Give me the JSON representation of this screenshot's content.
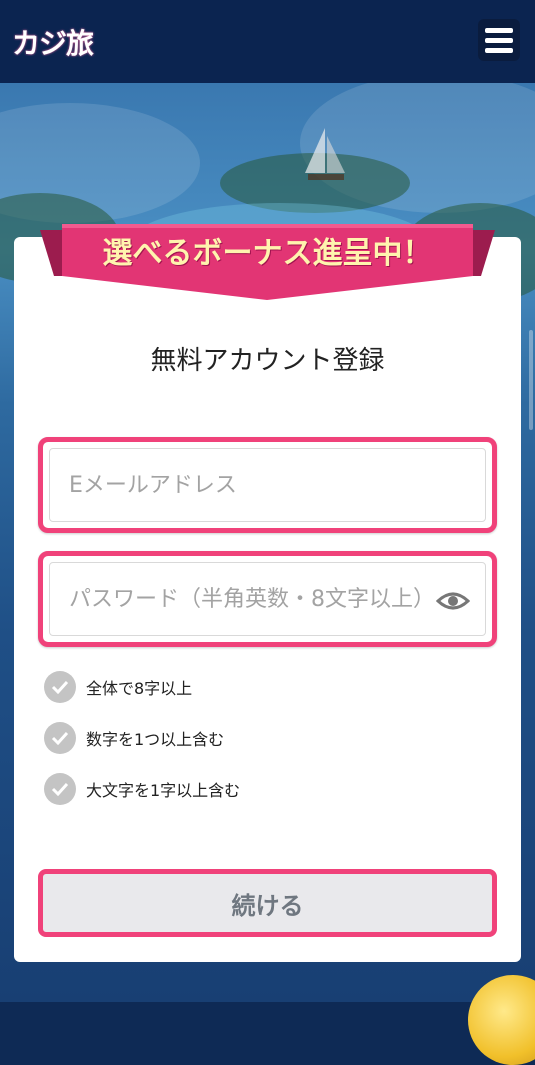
{
  "header": {
    "logo_text": "カジ旅",
    "menu_icon": "hamburger-menu-icon"
  },
  "banner": {
    "ribbon_text": "選べるボーナス進呈中！",
    "ribbon_color": "#e23574",
    "text_color": "#fff4ae"
  },
  "form": {
    "title": "無料アカウント登録",
    "email_placeholder": "Eメールアドレス",
    "password_placeholder": "パスワード（半角英数・8文字以上）",
    "password_toggle_icon": "eye-icon",
    "rules": [
      {
        "label": "全体で8字以上"
      },
      {
        "label": "数字を1つ以上含む"
      },
      {
        "label": "大文字を1字以上含む"
      }
    ],
    "continue_label": "続ける"
  },
  "colors": {
    "accent": "#f0427a",
    "header_bg": "#0b2450"
  }
}
